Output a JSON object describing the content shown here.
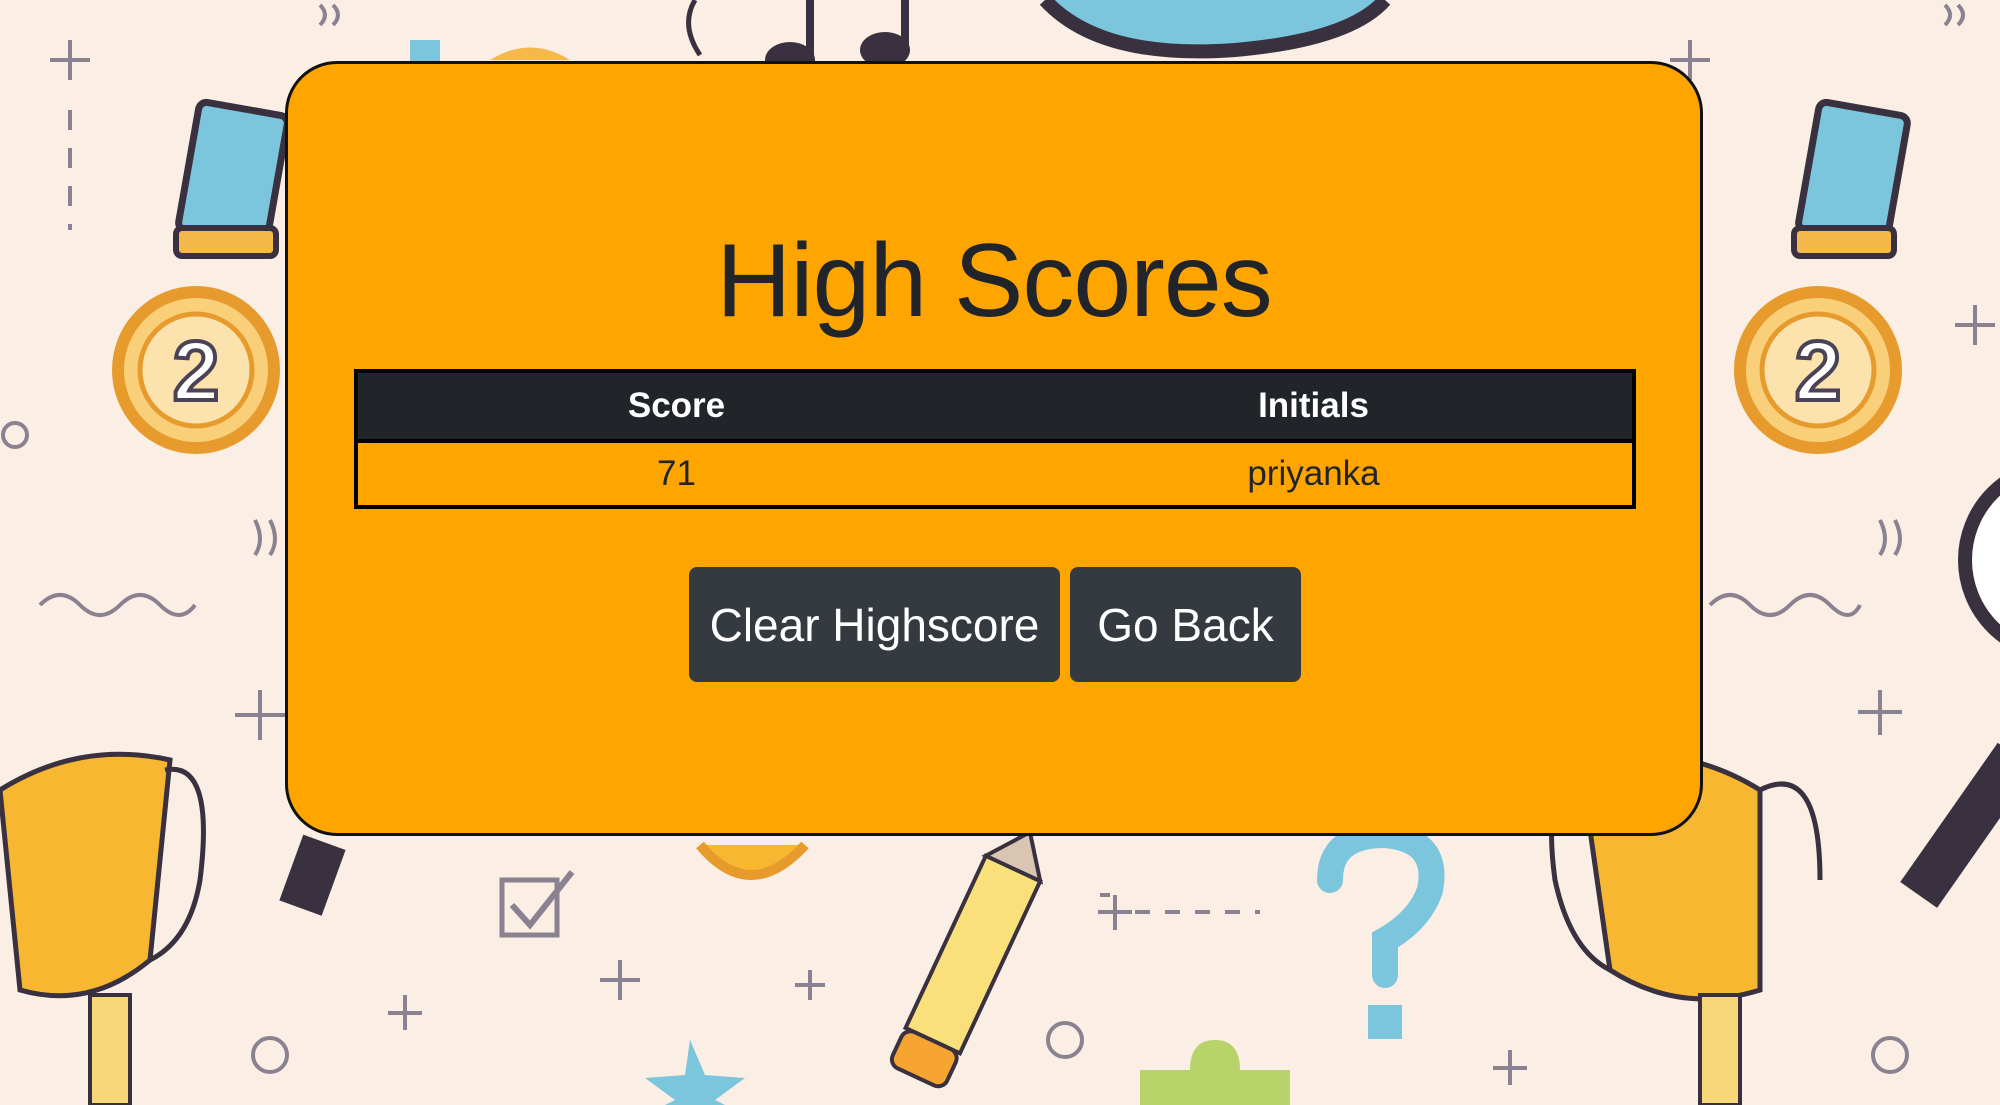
{
  "page": {
    "title": "High Scores"
  },
  "table": {
    "headers": {
      "score": "Score",
      "initials": "Initials"
    },
    "rows": [
      {
        "score": "71",
        "initials": "priyanka"
      }
    ]
  },
  "buttons": {
    "clear_label": "Clear Highscore",
    "back_label": "Go Back"
  },
  "colors": {
    "card_background": "#ffa500",
    "header_background": "#212529",
    "button_background": "#343a40",
    "page_background": "#fbeee4"
  },
  "background_icons": [
    "medal-icon",
    "trophy-icon",
    "pencil-icon",
    "question-mark-icon",
    "checkbox-icon",
    "music-note-icon",
    "globe-icon",
    "magnifier-icon",
    "star-icon",
    "puzzle-icon"
  ]
}
